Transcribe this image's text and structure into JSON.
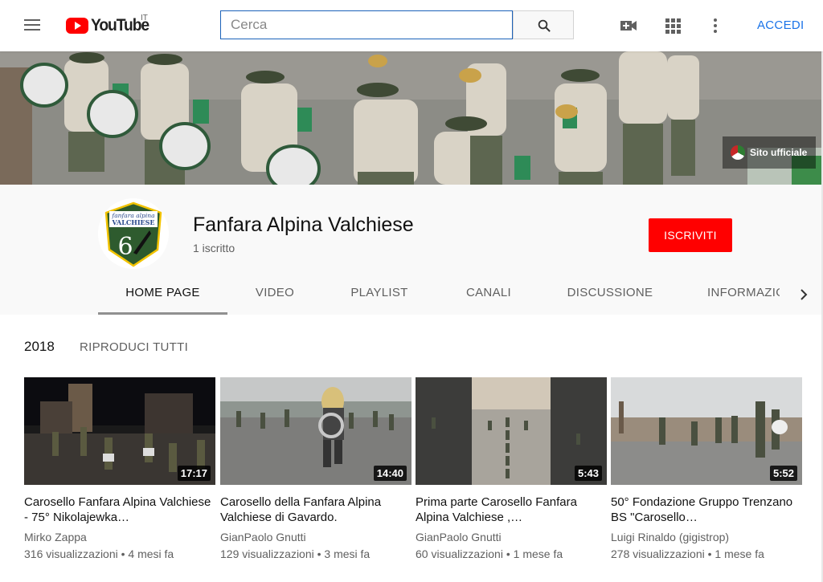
{
  "header": {
    "logo_text": "YouTube",
    "logo_region": "IT",
    "search_placeholder": "Cerca",
    "signin_label": "ACCEDI",
    "icons": [
      "menu-icon",
      "search-icon",
      "video-camera-icon",
      "apps-grid-icon",
      "more-vert-icon"
    ]
  },
  "banner": {
    "site_link_label": "Sito ufficiale"
  },
  "channel": {
    "title": "Fanfara Alpina Valchiese",
    "subscribers": "1 iscritto",
    "subscribe_label": "ISCRIVITI",
    "avatar_text_top": "fanfara alpina",
    "avatar_text_name": "VALCHIESE",
    "avatar_number": "6"
  },
  "tabs": [
    {
      "label": "HOME PAGE",
      "active": true
    },
    {
      "label": "VIDEO"
    },
    {
      "label": "PLAYLIST"
    },
    {
      "label": "CANALI"
    },
    {
      "label": "DISCUSSIONE"
    },
    {
      "label": "INFORMAZIONI"
    }
  ],
  "shelf": {
    "title": "2018",
    "play_all_label": "RIPRODUCI TUTTI",
    "videos": [
      {
        "title": "Carosello Fanfara Alpina Valchiese - 75° Nikolajewka…",
        "channel": "Mirko Zappa",
        "views": "316 visualizzazioni",
        "age": "4 mesi fa",
        "duration": "17:17"
      },
      {
        "title": "Carosello della Fanfara Alpina Valchiese di Gavardo.",
        "channel": "GianPaolo Gnutti",
        "views": "129 visualizzazioni",
        "age": "3 mesi fa",
        "duration": "14:40"
      },
      {
        "title": "Prima parte Carosello Fanfara Alpina Valchiese ,…",
        "channel": "GianPaolo Gnutti",
        "views": "60 visualizzazioni",
        "age": "1 mese fa",
        "duration": "5:43"
      },
      {
        "title": "50° Fondazione Gruppo Trenzano BS \"Carosello…",
        "channel": "Luigi Rinaldo (gigistrop)",
        "views": "278 visualizzazioni",
        "age": "1 mese fa",
        "duration": "5:52"
      }
    ]
  },
  "colors": {
    "brand_red": "#ff0000",
    "link_blue": "#1a73e8",
    "search_border": "#1c62b9"
  }
}
